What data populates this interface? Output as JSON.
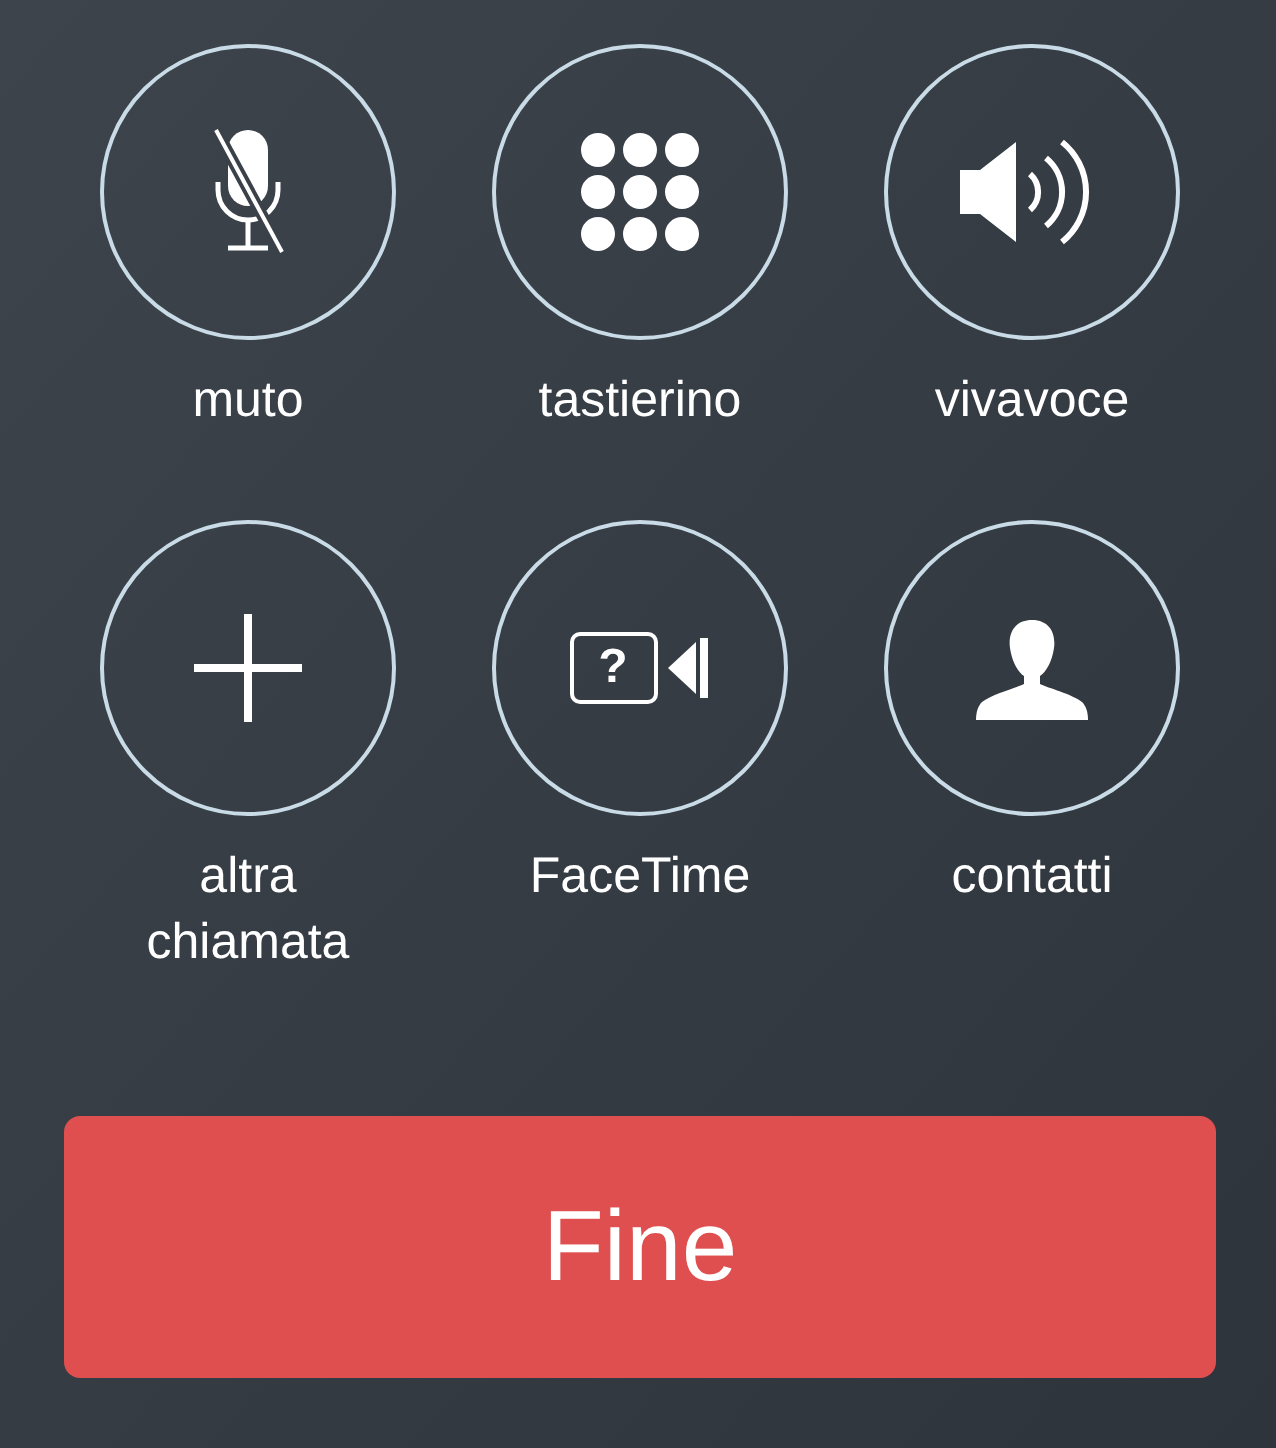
{
  "buttons": [
    {
      "kind": "mute",
      "label": "muto"
    },
    {
      "kind": "keypad",
      "label": "tastierino"
    },
    {
      "kind": "speaker",
      "label": "vivavoce"
    },
    {
      "kind": "add",
      "label": "altra chiamata"
    },
    {
      "kind": "facetime",
      "label": "FaceTime",
      "icon_text": "?"
    },
    {
      "kind": "contacts",
      "label": "contatti"
    }
  ],
  "end_button": {
    "label": "Fine"
  }
}
